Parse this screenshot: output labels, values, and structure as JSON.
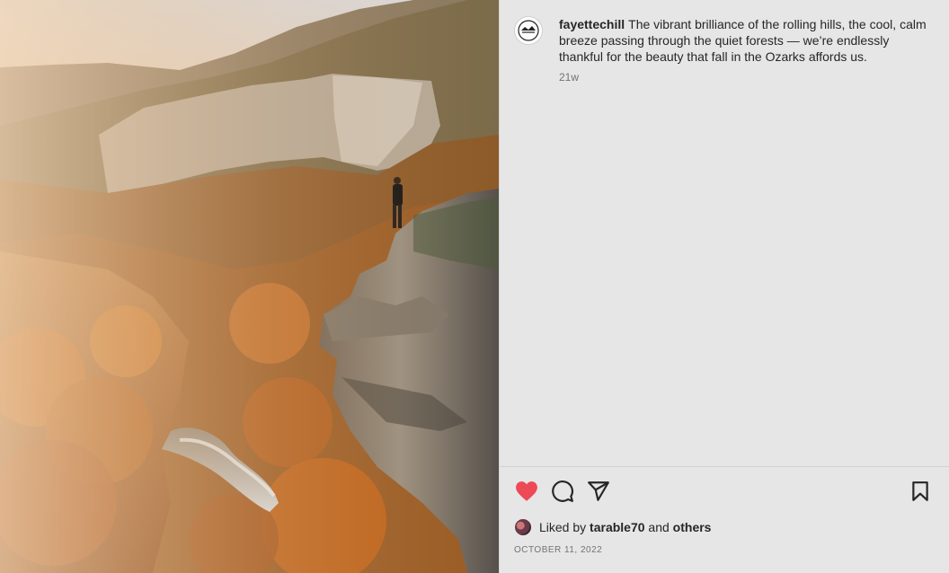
{
  "post": {
    "username": "fayettechill",
    "caption": "The vibrant brilliance of the rolling hills, the cool, calm breeze passing through the quiet forests — we’re endlessly thankful for the beauty that fall in the Ozarks affords us.",
    "time_ago": "21w"
  },
  "actions": {
    "like": "heart-icon",
    "comment": "comment-icon",
    "share": "share-icon",
    "save": "bookmark-icon",
    "like_color": "#ed4956"
  },
  "likes": {
    "prefix": "Liked by",
    "user": "tarable70",
    "conjunction": "and",
    "others": "others"
  },
  "date": "OCTOBER 11, 2022"
}
